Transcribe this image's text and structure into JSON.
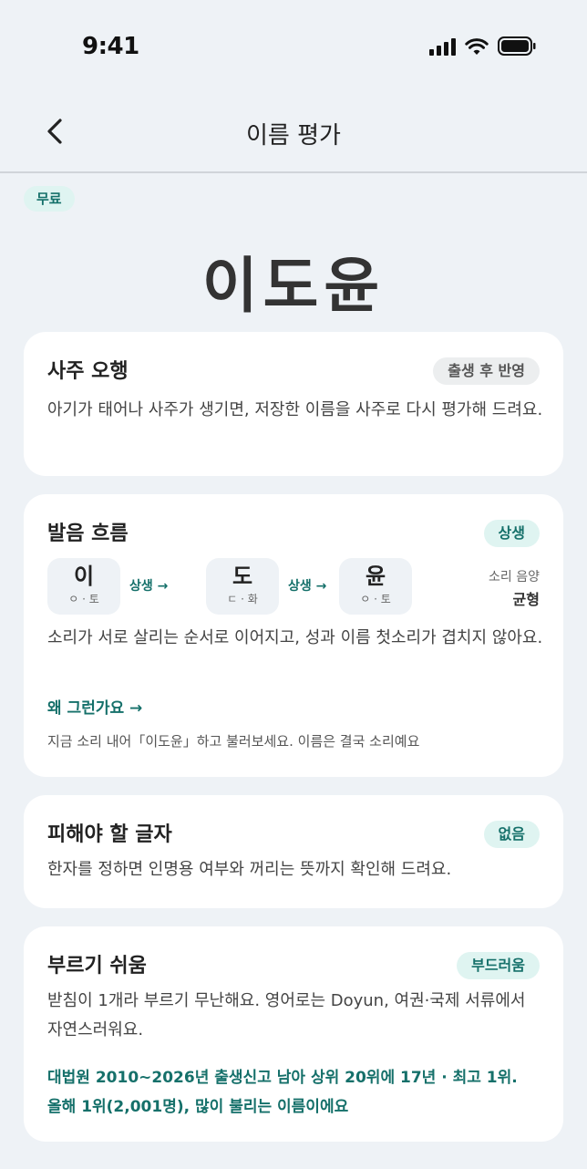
{
  "status": {
    "time": "9:41"
  },
  "nav": {
    "title": "이름 평가"
  },
  "badge": {
    "label": "무료"
  },
  "name": "이도윤",
  "saju": {
    "title": "사주 오행",
    "pill": "출생 후 반영",
    "desc": "아기가 태어나 사주가 생기면, 저장한 이름을 사주로 다시 평가해 드려요."
  },
  "pronunciation": {
    "title": "발음 흐름",
    "pill": "상생",
    "syllables": [
      {
        "char": "이",
        "sub": "ㅇ · 토"
      },
      {
        "char": "도",
        "sub": "ㄷ · 화"
      },
      {
        "char": "윤",
        "sub": "ㅇ · 토"
      }
    ],
    "connectors": [
      "상생 →",
      "상생 →"
    ],
    "sound_label": "소리 음양",
    "sound_value": "균형",
    "desc": "소리가 서로 살리는 순서로 이어지고, 성과 이름 첫소리가 겹치지 않아요.",
    "link": "왜 그런가요 →",
    "hint": "지금 소리 내어「이도윤」하고 불러보세요. 이름은 결국 소리예요"
  },
  "avoid": {
    "title": "피해야 할 글자",
    "pill": "없음",
    "desc": "한자를 정하면 인명용 여부와 꺼리는 뜻까지 확인해 드려요."
  },
  "ease": {
    "title": "부르기 쉬움",
    "pill": "부드러움",
    "desc": "받침이 1개라 부르기 무난해요. 영어로는 Doyun, 여권·국제 서류에서 자연스러워요.",
    "stats": "대법원 2010~2026년 출생신고 남아 상위 20위에 17년 · 최고 1위. 올해 1위(2,001명), 많이 불리는 이름이에요"
  },
  "colors": {
    "accent": "#15706a",
    "accent_bg": "#dff4f1",
    "background": "#eef2f6"
  }
}
